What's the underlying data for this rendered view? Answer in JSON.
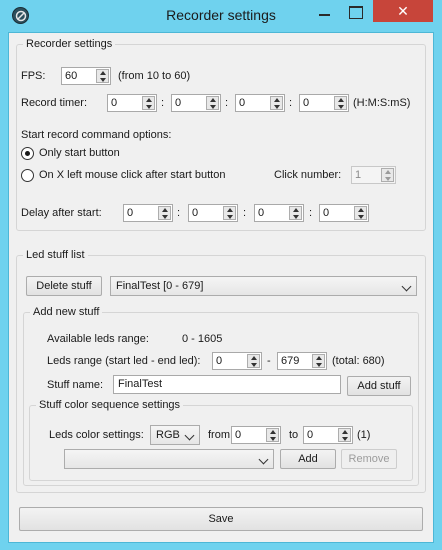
{
  "window": {
    "title": "Recorder settings",
    "close_symbol": "✕"
  },
  "recorder": {
    "legend": "Recorder settings",
    "fps_label": "FPS:",
    "fps_value": "60",
    "fps_range": "(from 10 to 60)",
    "timer_label": "Record timer:",
    "timer_values": [
      "0",
      "0",
      "0",
      "0"
    ],
    "timer_sep": ":",
    "timer_format": "(H:M:S:mS)",
    "start_options_label": "Start record command options:",
    "option_only_start": "Only start button",
    "option_mouse_click": "On X left mouse click after start button",
    "click_number_label": "Click number:",
    "click_number_value": "1",
    "delay_label": "Delay after start:",
    "delay_values": [
      "0",
      "0",
      "0",
      "0"
    ]
  },
  "led_list": {
    "legend": "Led stuff list",
    "delete_label": "Delete stuff",
    "selected_stuff": "FinalTest [0 - 679]"
  },
  "add_new": {
    "legend": "Add new stuff",
    "available_label": "Available leds range:",
    "available_value": "0 - 1605",
    "range_label": "Leds range (start led - end led):",
    "range_start": "0",
    "range_dash": "-",
    "range_end": "679",
    "total": "(total: 680)",
    "name_label": "Stuff name:",
    "name_value": "FinalTest",
    "add_stuff_label": "Add stuff"
  },
  "color_seq": {
    "legend": "Stuff color sequence settings",
    "leds_color_label": "Leds color settings:",
    "color_mode": "RGB",
    "from_label": "from",
    "from_value": "0",
    "to_label": "to",
    "to_value": "0",
    "count": "(1)",
    "sequence_value": "",
    "add_label": "Add",
    "remove_label": "Remove"
  },
  "footer": {
    "save_label": "Save"
  },
  "colors": {
    "titlebar": "#6fd2ee",
    "close_button": "#c7453a"
  },
  "icons": [
    "app-icon",
    "minimize-icon",
    "maximize-icon",
    "close-icon",
    "chevron-down-icon",
    "spin-arrows-icon"
  ]
}
